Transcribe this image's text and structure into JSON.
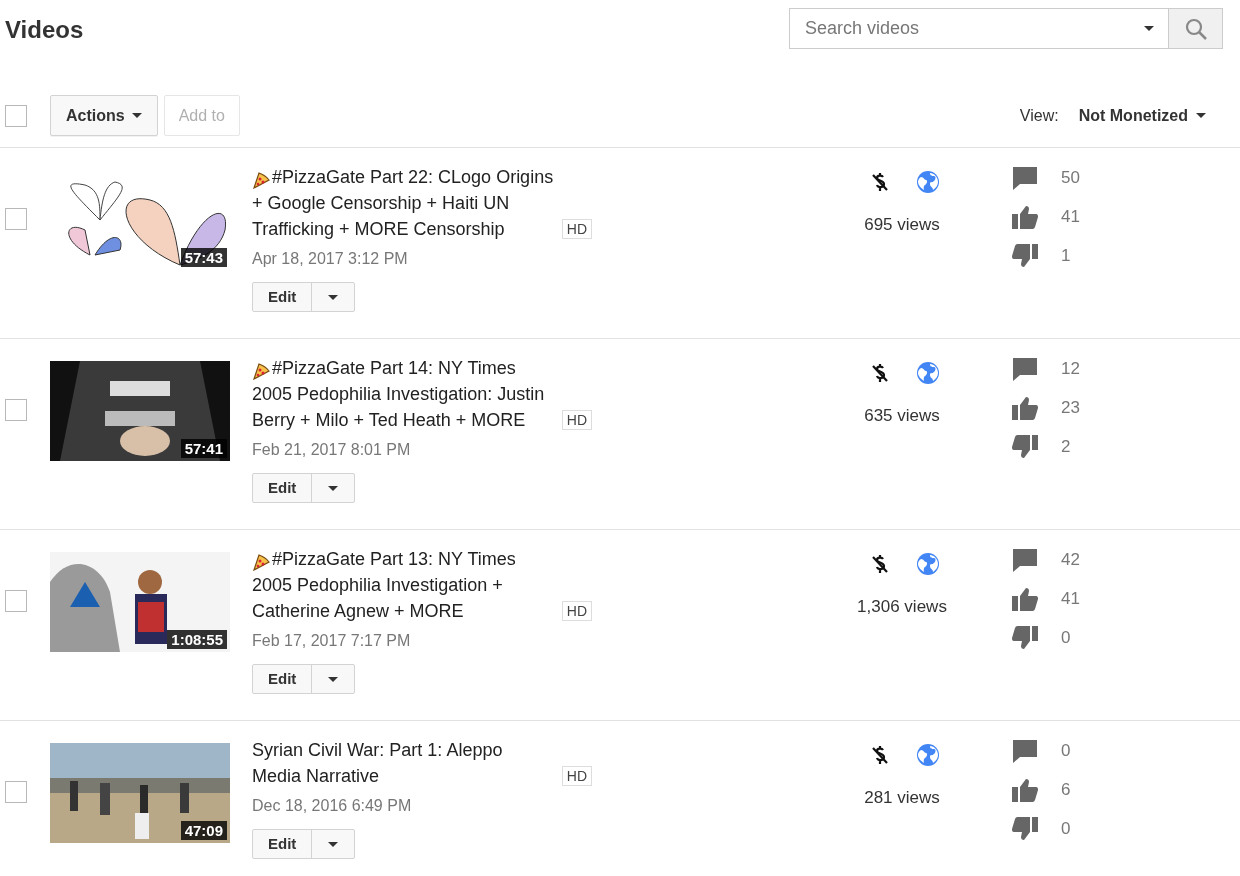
{
  "header": {
    "title": "Videos",
    "search": {
      "placeholder": "Search videos"
    }
  },
  "toolbar": {
    "select_all": {
      "checked": false
    },
    "actions_button": "Actions",
    "add_to_button": {
      "label": "Add to",
      "disabled": true
    },
    "view_label": "View:",
    "view_value": "Not Monetized"
  },
  "videos": [
    {
      "checked": false,
      "duration": "57:43",
      "has_pizza_icon": true,
      "title": "#PizzaGate Part 22: CLogo Origins + Google Censorship + Haiti UN Trafficking + MORE Censorship",
      "hd": "HD",
      "date": "Apr 18, 2017 3:12 PM",
      "edit": "Edit",
      "views": "695 views",
      "comments": "50",
      "likes": "41",
      "dislikes": "1"
    },
    {
      "checked": false,
      "duration": "57:41",
      "has_pizza_icon": true,
      "title": "#PizzaGate Part 14: NY Times 2005 Pedophilia Investigation: Justin Berry + Milo + Ted Heath + MORE",
      "hd": "HD",
      "date": "Feb 21, 2017 8:01 PM",
      "edit": "Edit",
      "views": "635 views",
      "comments": "12",
      "likes": "23",
      "dislikes": "2"
    },
    {
      "checked": false,
      "duration": "1:08:55",
      "has_pizza_icon": true,
      "title": "#PizzaGate Part 13: NY Times 2005 Pedophilia Investigation + Catherine Agnew + MORE",
      "hd": "HD",
      "date": "Feb 17, 2017 7:17 PM",
      "edit": "Edit",
      "views": "1,306 views",
      "comments": "42",
      "likes": "41",
      "dislikes": "0"
    },
    {
      "checked": false,
      "duration": "47:09",
      "has_pizza_icon": false,
      "title": "Syrian Civil War: Part 1: Aleppo Media Narrative",
      "hd": "HD",
      "date": "Dec 18, 2016 6:49 PM",
      "edit": "Edit",
      "views": "281 views",
      "comments": "0",
      "likes": "6",
      "dislikes": "0"
    }
  ]
}
